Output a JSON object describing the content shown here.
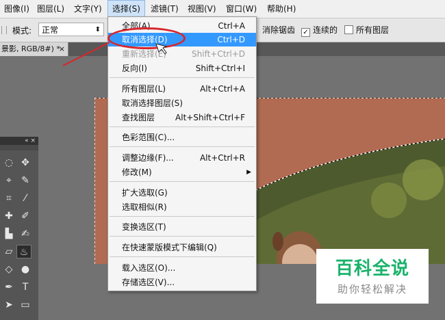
{
  "menubar": {
    "items": [
      "图像(I)",
      "图层(L)",
      "文字(Y)",
      "选择(S)",
      "滤镜(T)",
      "视图(V)",
      "窗口(W)",
      "帮助(H)"
    ]
  },
  "options": {
    "mode_label": "模式:",
    "mode_value": "正常",
    "antialias_label": "消除锯齿",
    "contiguous_label": "连续的",
    "all_layers_label": "所有图层",
    "contiguous_checked": true,
    "all_layers_checked": false
  },
  "document": {
    "tab_title": "景影, RGB/8#) *",
    "close": "×"
  },
  "select_menu": {
    "items": [
      {
        "label": "全部(A)",
        "shortcut": "Ctrl+A",
        "state": "normal"
      },
      {
        "label": "取消选择(D)",
        "shortcut": "Ctrl+D",
        "state": "highlighted"
      },
      {
        "label": "重新选择(E)",
        "shortcut": "Shift+Ctrl+D",
        "state": "disabled"
      },
      {
        "label": "反向(I)",
        "shortcut": "Shift+Ctrl+I",
        "state": "normal"
      },
      {
        "label": "所有图层(L)",
        "shortcut": "Alt+Ctrl+A",
        "state": "normal"
      },
      {
        "label": "取消选择图层(S)",
        "shortcut": "",
        "state": "normal"
      },
      {
        "label": "查找图层",
        "shortcut": "Alt+Shift+Ctrl+F",
        "state": "normal"
      },
      {
        "label": "色彩范围(C)...",
        "shortcut": "",
        "state": "normal"
      },
      {
        "label": "调整边缘(F)...",
        "shortcut": "Alt+Ctrl+R",
        "state": "normal"
      },
      {
        "label": "修改(M)",
        "shortcut": "",
        "state": "submenu"
      },
      {
        "label": "扩大选取(G)",
        "shortcut": "",
        "state": "normal"
      },
      {
        "label": "选取相似(R)",
        "shortcut": "",
        "state": "normal"
      },
      {
        "label": "变换选区(T)",
        "shortcut": "",
        "state": "normal"
      },
      {
        "label": "在快速蒙版模式下编辑(Q)",
        "shortcut": "",
        "state": "normal"
      },
      {
        "label": "载入选区(O)...",
        "shortcut": "",
        "state": "normal"
      },
      {
        "label": "存储选区(V)...",
        "shortcut": "",
        "state": "normal"
      }
    ]
  },
  "tools": {
    "panel_header": "«  ×",
    "icons": [
      "lasso-icon",
      "move-icon",
      "polygon-lasso-icon",
      "quick-select-icon",
      "crop-icon",
      "eyedropper-icon",
      "healing-icon",
      "brush-icon",
      "stamp-icon",
      "history-brush-icon",
      "eraser-icon",
      "paint-bucket-icon",
      "blur-icon",
      "dodge-icon",
      "pen-icon",
      "type-icon",
      "path-select-icon",
      "rectangle-icon"
    ]
  },
  "watermark": {
    "title": "百科全说",
    "subtitle": "助你轻松解决"
  },
  "colors": {
    "highlight": "#3399ff",
    "annotation": "#d8262c",
    "canvas_brown": "#b06b52",
    "watermark_green": "#19b36b"
  }
}
